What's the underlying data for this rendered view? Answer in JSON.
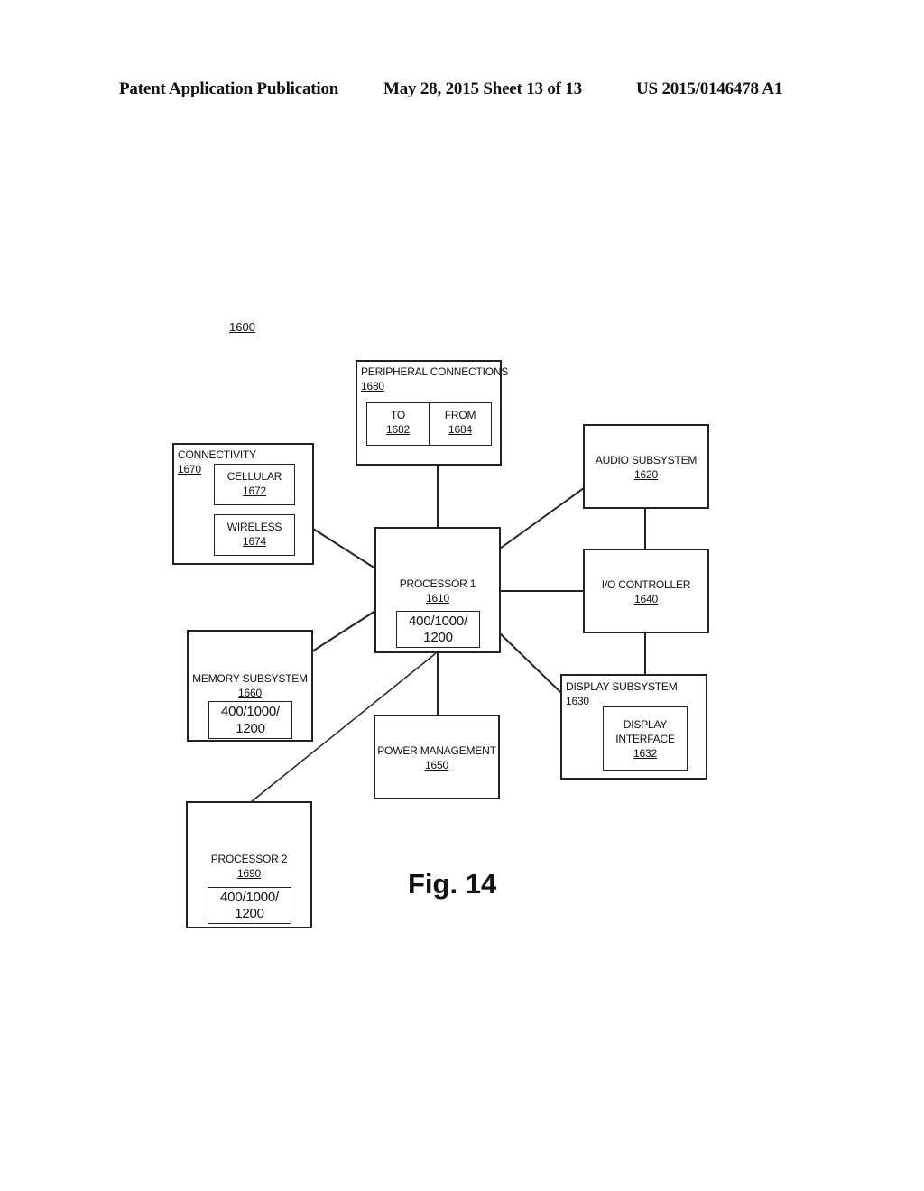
{
  "header": {
    "publication": "Patent Application Publication",
    "date_sheet": "May 28, 2015  Sheet 13 of 13",
    "patent_number": "US 2015/0146478 A1"
  },
  "diagram": {
    "reference": "1600",
    "figure_label": "Fig. 14",
    "peripheral": {
      "title": "PERIPHERAL CONNECTIONS",
      "num": "1680",
      "to": {
        "title": "TO",
        "num": "1682"
      },
      "from": {
        "title": "FROM",
        "num": "1684"
      }
    },
    "connectivity": {
      "title": "CONNECTIVITY",
      "num": "1670",
      "cellular": {
        "title": "CELLULAR",
        "num": "1672"
      },
      "wireless": {
        "title": "WIRELESS",
        "num": "1674"
      }
    },
    "audio": {
      "title": "AUDIO SUBSYSTEM",
      "num": "1620"
    },
    "processor1": {
      "title": "PROCESSOR 1",
      "num": "1610",
      "inner_line1": "400/1000/",
      "inner_line2": "1200"
    },
    "io": {
      "title": "I/O CONTROLLER",
      "num": "1640"
    },
    "memory": {
      "title": "MEMORY SUBSYSTEM",
      "num": "1660",
      "inner_line1": "400/1000/",
      "inner_line2": "1200"
    },
    "display": {
      "title": "DISPLAY SUBSYSTEM",
      "num": "1630",
      "interface": {
        "line1": "DISPLAY",
        "line2": "INTERFACE",
        "num": "1632"
      }
    },
    "power": {
      "title": "POWER MANAGEMENT",
      "num": "1650"
    },
    "processor2": {
      "title": "PROCESSOR 2",
      "num": "1690",
      "inner_line1": "400/1000/",
      "inner_line2": "1200"
    }
  }
}
